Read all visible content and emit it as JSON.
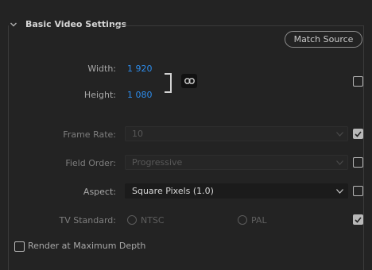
{
  "section": {
    "title": "Basic Video Settings",
    "match_source_label": "Match Source"
  },
  "width": {
    "label": "Width:",
    "value": "1 920"
  },
  "height": {
    "label": "Height:",
    "value": "1 080"
  },
  "frame_rate": {
    "label": "Frame Rate:",
    "value": "10",
    "checked": true
  },
  "field_order": {
    "label": "Field Order:",
    "value": "Progressive",
    "checked": false
  },
  "aspect": {
    "label": "Aspect:",
    "value": "Square Pixels (1.0)",
    "checked": false
  },
  "tv_standard": {
    "label": "TV Standard:",
    "options": [
      "NTSC",
      "PAL"
    ],
    "checked": true
  },
  "render_max_depth": {
    "label": "Render at Maximum Depth",
    "checked": false
  },
  "colors": {
    "accent_blue": "#2d8ceb",
    "background": "#232323"
  }
}
